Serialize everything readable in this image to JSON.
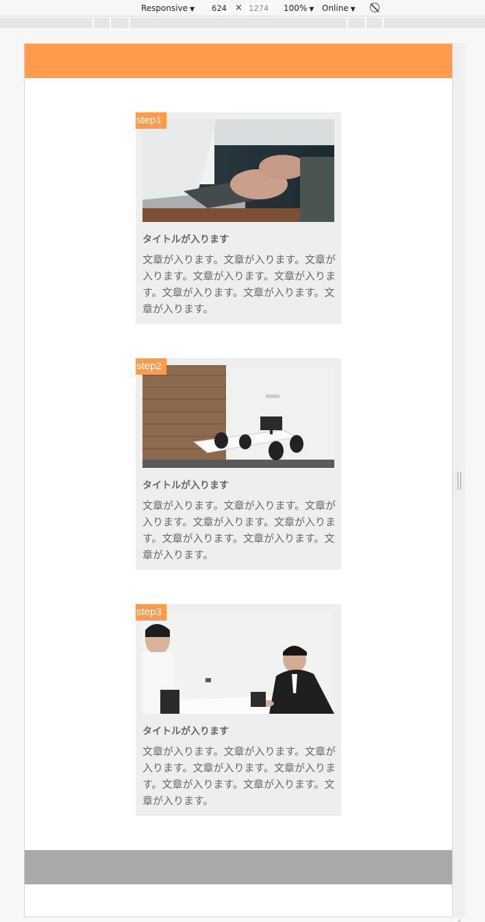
{
  "devtools": {
    "device_mode": "Responsive",
    "width": "624",
    "height": "1274",
    "times": "×",
    "zoom": "100%",
    "network": "Online",
    "caret": "▼"
  },
  "cards": [
    {
      "step": "step1",
      "title": "タイトルが入ります",
      "text": "文章が入ります。文章が入ります。文章が入ります。文章が入ります。文章が入ります。文章が入ります。文章が入ります。文章が入ります。"
    },
    {
      "step": "step2",
      "title": "タイトルが入ります",
      "text": "文章が入ります。文章が入ります。文章が入ります。文章が入ります。文章が入ります。文章が入ります。文章が入ります。文章が入ります。"
    },
    {
      "step": "step3",
      "title": "タイトルが入ります",
      "text": "文章が入ります。文章が入ります。文章が入ります。文章が入ります。文章が入ります。文章が入ります。文章が入ります。文章が入ります。"
    }
  ],
  "colors": {
    "accent": "#ff9b4a",
    "footer": "#a9a9a9",
    "card_bg": "#eeeeee",
    "text": "#666666"
  }
}
